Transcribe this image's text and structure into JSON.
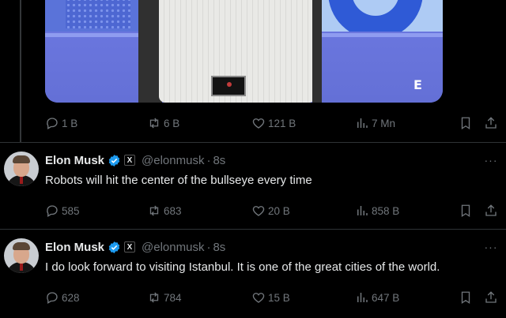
{
  "top_post": {
    "media": {
      "watermark": "E"
    },
    "actions": {
      "reply_count": "1 B",
      "repost_count": "6 B",
      "like_count": "121 B",
      "view_count": "7 Mn"
    }
  },
  "tweets": [
    {
      "name": "Elon Musk",
      "handle": "@elonmusk",
      "separator": "·",
      "time": "8s",
      "more_label": "···",
      "text": "Robots will hit the center of the bullseye every time",
      "reply_count": "585",
      "repost_count": "683",
      "like_count": "20 B",
      "view_count": "858 B"
    },
    {
      "name": "Elon Musk",
      "handle": "@elonmusk",
      "separator": "·",
      "time": "8s",
      "more_label": "···",
      "text": "I do look forward to visiting Istanbul. It is one of the great cities of the world.",
      "reply_count": "628",
      "repost_count": "784",
      "like_count": "15 B",
      "view_count": "647 B"
    }
  ],
  "badges": {
    "affiliate_label": "X"
  },
  "icons": {
    "reply": "reply-icon",
    "repost": "repost-icon",
    "like": "heart-icon",
    "views": "views-icon",
    "bookmark": "bookmark-icon",
    "share": "share-icon",
    "verified": "verified-badge-icon"
  },
  "colors": {
    "background": "#000000",
    "text_primary": "#e7e9ea",
    "text_secondary": "#71767b",
    "verified_blue": "#1d9bf0",
    "divider": "#2f3336"
  }
}
